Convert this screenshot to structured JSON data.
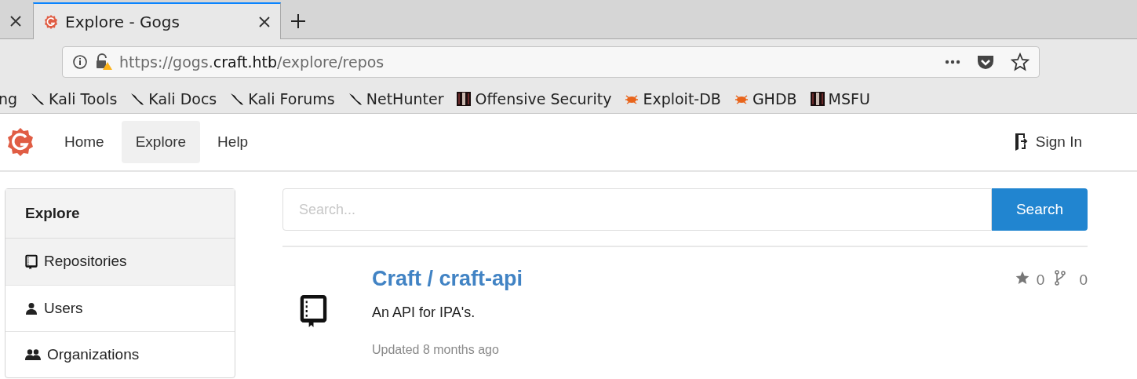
{
  "browser": {
    "tabs": [
      {
        "selected": false
      },
      {
        "title": "Explore - Gogs",
        "selected": true
      }
    ],
    "url": {
      "prefix": "https://gogs.",
      "domain": "craft.htb",
      "path": "/explore/repos"
    },
    "bookmarks": [
      {
        "label": "ng",
        "kind": "none"
      },
      {
        "label": "Kali Tools",
        "kind": "kali"
      },
      {
        "label": "Kali Docs",
        "kind": "kali"
      },
      {
        "label": "Kali Forums",
        "kind": "kali"
      },
      {
        "label": "NetHunter",
        "kind": "kali"
      },
      {
        "label": "Offensive Security",
        "kind": "offsec"
      },
      {
        "label": "Exploit-DB",
        "kind": "bug"
      },
      {
        "label": "GHDB",
        "kind": "bug"
      },
      {
        "label": "MSFU",
        "kind": "offsec"
      }
    ]
  },
  "nav": {
    "items": [
      {
        "label": "Home",
        "selected": false
      },
      {
        "label": "Explore",
        "selected": true
      },
      {
        "label": "Help",
        "selected": false
      }
    ],
    "sign_in": "Sign In"
  },
  "sidebar": {
    "title": "Explore",
    "items": [
      {
        "label": "Repositories",
        "kind": "repo",
        "selected": true
      },
      {
        "label": "Users",
        "kind": "user",
        "selected": false
      },
      {
        "label": "Organizations",
        "kind": "org",
        "selected": false
      }
    ]
  },
  "search": {
    "placeholder": "Search...",
    "button": "Search"
  },
  "repos": [
    {
      "name": "Craft / craft-api",
      "description": "An API for IPA's.",
      "updated": "Updated 8 months ago",
      "stars": "0",
      "forks": "0"
    }
  ]
}
